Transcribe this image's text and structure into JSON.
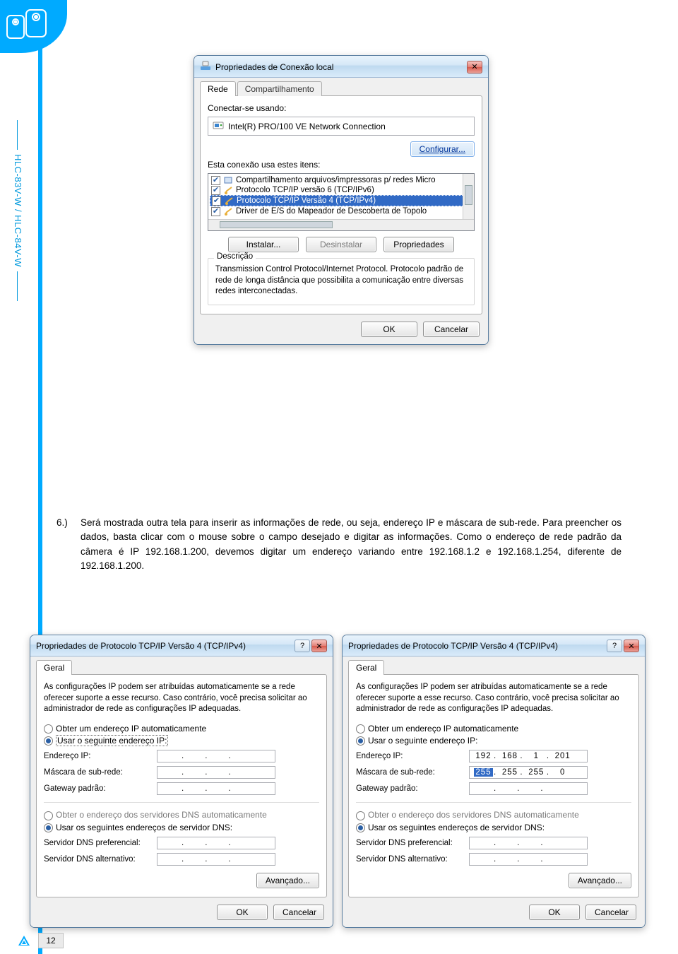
{
  "sidebar_label": "HLC-83V-W / HLC-84V-W",
  "instruction": {
    "number": "6.)",
    "text": "Será mostrada outra tela para inserir as informações de rede, ou seja, endereço IP e máscara de sub-rede. Para preencher os dados, basta clicar com o mouse sobre o campo desejado e digitar as informações. Como o endereço de rede padrão da câmera é IP  192.168.1.200, devemos digitar um endereço variando entre 192.168.1.2 e 192.168.1.254, diferente de 192.168.1.200."
  },
  "page_number": "12",
  "dlgMain": {
    "title": "Propriedades de Conexão local",
    "tabs": {
      "active": "Rede",
      "inactive": "Compartilhamento"
    },
    "connect_label": "Conectar-se usando:",
    "adapter": "Intel(R) PRO/100 VE Network Connection",
    "configure_btn": "Configurar...",
    "items_label": "Esta conexão usa estes itens:",
    "items": [
      "Compartilhamento arquivos/impressoras p/ redes Micro",
      "Protocolo TCP/IP versão 6 (TCP/IPv6)",
      "Protocolo TCP/IP Versão 4 (TCP/IPv4)",
      "Driver de E/S do Mapeador de Descoberta de Topolo"
    ],
    "install_btn": "Instalar...",
    "uninstall_btn": "Desinstalar",
    "props_btn": "Propriedades",
    "desc_label": "Descrição",
    "desc_text": "Transmission Control Protocol/Internet Protocol. Protocolo padrão de rede de longa distância que possibilita a comunicação entre diversas redes interconectadas.",
    "ok": "OK",
    "cancel": "Cancelar"
  },
  "dlgIP": {
    "title": "Propriedades de Protocolo TCP/IP Versão 4 (TCP/IPv4)",
    "tab": "Geral",
    "intro": "As configurações IP podem ser atribuídas automaticamente se a rede oferecer suporte a esse recurso. Caso contrário, você precisa solicitar ao administrador de rede as configurações IP adequadas.",
    "opt_auto_ip": "Obter um endereço IP automaticamente",
    "opt_manual_ip": "Usar o seguinte endereço IP:",
    "ip_label": "Endereço IP:",
    "mask_label": "Máscara de sub-rede:",
    "gw_label": "Gateway padrão:",
    "opt_auto_dns": "Obter o endereço dos servidores DNS automaticamente",
    "opt_manual_dns": "Usar os seguintes endereços de servidor DNS:",
    "dns1_label": "Servidor DNS preferencial:",
    "dns2_label": "Servidor DNS alternativo:",
    "advanced_btn": "Avançado...",
    "ok": "OK",
    "cancel": "Cancelar",
    "right": {
      "ip": [
        "192",
        "168",
        "1",
        "201"
      ],
      "mask": [
        "255",
        "255",
        "255",
        "0"
      ]
    }
  }
}
